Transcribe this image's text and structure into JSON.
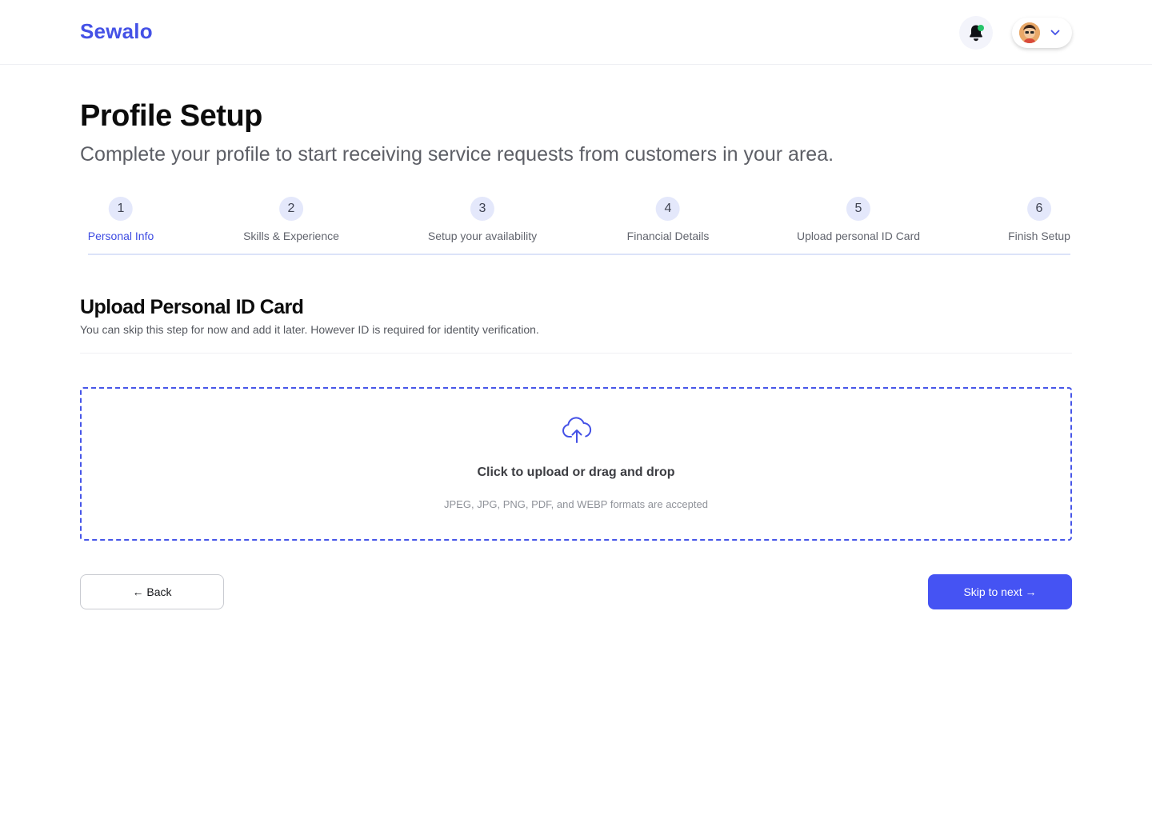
{
  "header": {
    "logo": "Sewalo"
  },
  "page": {
    "title": "Profile Setup",
    "subtitle": "Complete your profile to start receiving service requests from customers in your area."
  },
  "steps": [
    {
      "number": "1",
      "label": "Personal Info",
      "active": true
    },
    {
      "number": "2",
      "label": "Skills & Experience",
      "active": false
    },
    {
      "number": "3",
      "label": "Setup your availability",
      "active": false
    },
    {
      "number": "4",
      "label": "Financial Details",
      "active": false
    },
    {
      "number": "5",
      "label": "Upload personal ID Card",
      "active": false
    },
    {
      "number": "6",
      "label": "Finish Setup",
      "active": false
    }
  ],
  "section": {
    "title": "Upload Personal ID Card",
    "description": "You can skip this step for now and add it later. However ID is required for identity verification."
  },
  "upload": {
    "icon": "cloud-upload-icon",
    "title": "Click to upload or drag and drop",
    "hint": "JPEG, JPG, PNG, PDF, and WEBP formats are accepted"
  },
  "actions": {
    "back_label": "← Back",
    "next_label": "Skip to next →"
  },
  "colors": {
    "brand": "#4451e6",
    "primary_button": "#4553f3",
    "notification_dot": "#27c46b"
  }
}
